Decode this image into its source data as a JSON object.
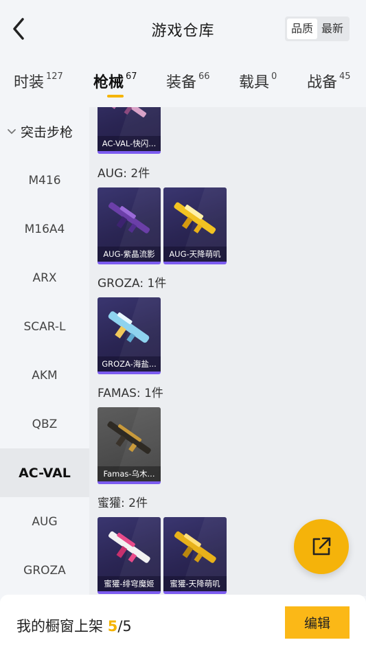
{
  "header": {
    "title": "游戏仓库",
    "sort_options": [
      {
        "label": "品质",
        "active": true
      },
      {
        "label": "最新",
        "active": false
      }
    ]
  },
  "tabs": [
    {
      "label": "时装",
      "count": "127",
      "active": false
    },
    {
      "label": "枪械",
      "count": "67",
      "active": true
    },
    {
      "label": "装备",
      "count": "66",
      "active": false
    },
    {
      "label": "载具",
      "count": "0",
      "active": false
    },
    {
      "label": "战备",
      "count": "45",
      "active": false
    }
  ],
  "sidebar": {
    "group_label": "突击步枪",
    "items": [
      {
        "label": "M416",
        "active": false
      },
      {
        "label": "M16A4",
        "active": false
      },
      {
        "label": "ARX",
        "active": false
      },
      {
        "label": "SCAR-L",
        "active": false
      },
      {
        "label": "AKM",
        "active": false
      },
      {
        "label": "QBZ",
        "active": false
      },
      {
        "label": "AC-VAL",
        "active": true
      },
      {
        "label": "AUG",
        "active": false
      },
      {
        "label": "GROZA",
        "active": false
      }
    ]
  },
  "content": {
    "top_card": {
      "label": "AC-VAL-快闪..."
    },
    "sections": [
      {
        "title": "AUG: 2件",
        "cards": [
          {
            "label": "AUG-紫晶流影"
          },
          {
            "label": "AUG-天降萌叽"
          }
        ]
      },
      {
        "title": "GROZA: 1件",
        "cards": [
          {
            "label": "GROZA-海盐..."
          }
        ]
      },
      {
        "title": "FAMAS: 1件",
        "cards": [
          {
            "label": "Famas-乌木..."
          }
        ]
      },
      {
        "title": "蜜獾: 2件",
        "cards": [
          {
            "label": "蜜獾-绯穹魔姬"
          },
          {
            "label": "蜜獾-天降萌叽"
          }
        ]
      }
    ]
  },
  "bottom": {
    "label": "我的橱窗上架",
    "current": "5",
    "separator": "/5",
    "edit_label": "编辑"
  },
  "colors": {
    "accent": "#f5b400",
    "card_purple": "#2a2553",
    "card_border": "#7c5cf0"
  },
  "icons": {
    "back": "chevron-left-icon",
    "share": "external-link-icon",
    "group_toggle": "chevron-down-icon"
  }
}
